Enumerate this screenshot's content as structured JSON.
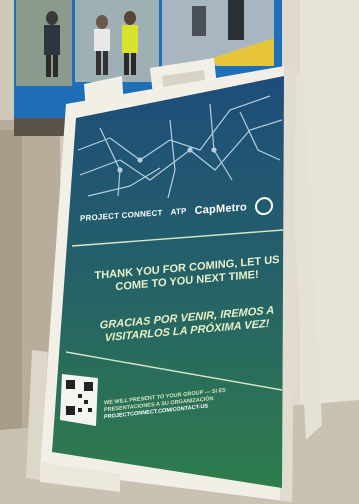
{
  "sign": {
    "logo_left": "Project Connect",
    "logo_middle": "ATP",
    "logo_capmetro": "CapMetro",
    "message_en": "Thank you for coming, let us come to you next time!",
    "message_es": "Gracias por venir, iremos a visitarlos la próxima vez!",
    "contact_text": "We will present to your group — si es presentaciones a su organización",
    "contact_url": "ProjectConnect.com/contact-us"
  },
  "colors": {
    "sign_frame": "#f2efe6",
    "panel_green": "#2f7d4c",
    "panel_blue": "#1d4d7a",
    "screen_blue": "#1f6fb7"
  }
}
